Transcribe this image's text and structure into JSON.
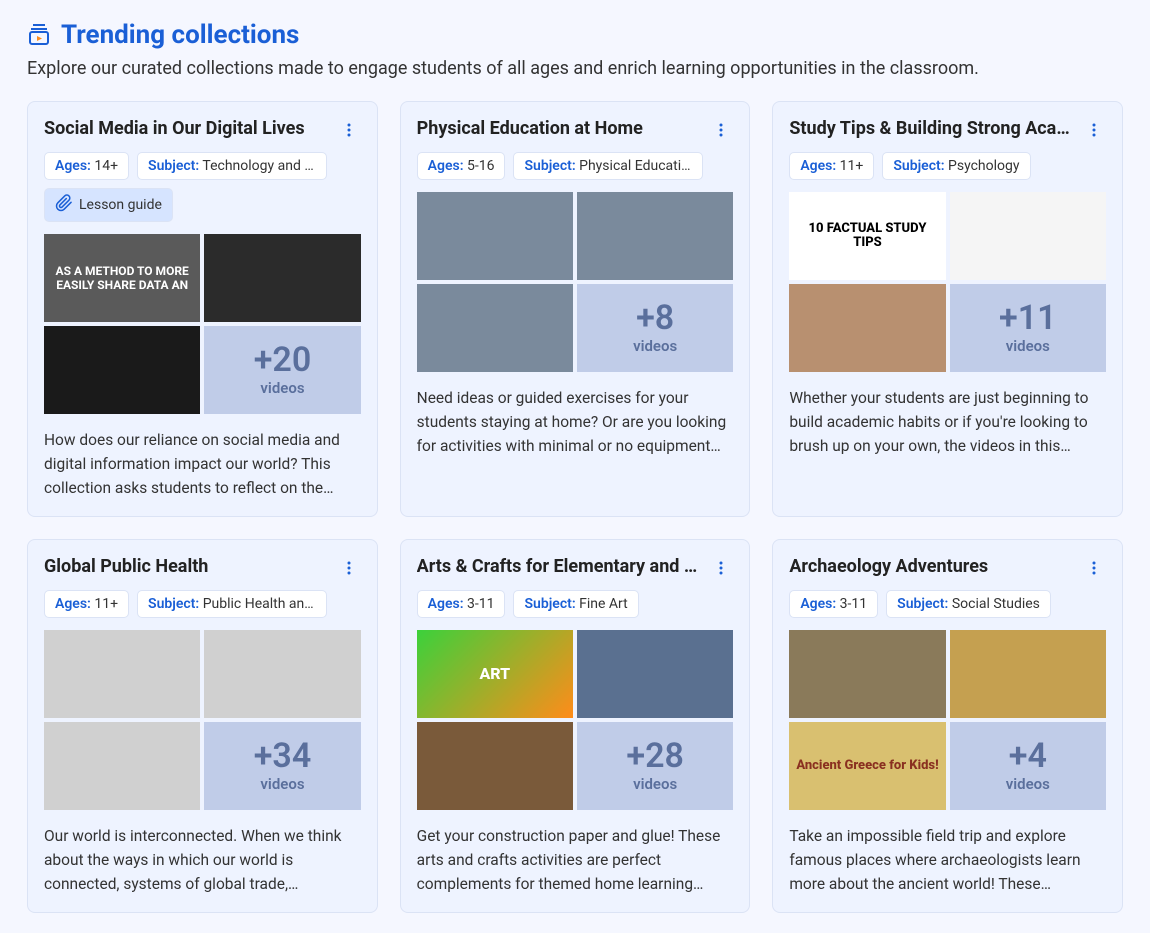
{
  "header": {
    "title": "Trending collections",
    "subtitle": "Explore our curated collections made to engage students of all ages and enrich learning opportunities in the classroom."
  },
  "labels": {
    "ages": "Ages:",
    "subject": "Subject:",
    "lesson_guide": "Lesson guide",
    "videos": "videos"
  },
  "cards": [
    {
      "title": "Social Media in Our Digital Lives",
      "ages": "14+",
      "subject": "Technology and C…",
      "has_lesson_guide": true,
      "more_count": "+20",
      "description": "How does our reliance on social media and digital information impact our world? This collection asks students to reflect on the…",
      "thumbs": [
        "t1",
        "t2",
        "t3"
      ],
      "thumb_text_1": "AS A METHOD TO MORE EASILY SHARE DATA AN"
    },
    {
      "title": "Physical Education at Home",
      "ages": "5-16",
      "subject": "Physical Education",
      "has_lesson_guide": false,
      "more_count": "+8",
      "description": "Need ideas or guided exercises for your students staying at home? Or are you looking for activities with minimal or no equipment…",
      "thumbs": [
        "pe1",
        "pe2",
        "pe3"
      ]
    },
    {
      "title": "Study Tips & Building Strong Acad…",
      "ages": "11+",
      "subject": "Psychology",
      "has_lesson_guide": false,
      "more_count": "+11",
      "description": "Whether your students are just beginning to build academic habits or if you're looking to brush up on your own, the videos in this…",
      "thumbs": [
        "st1",
        "st2",
        "st3"
      ],
      "thumb_text_1": "10 FACTUAL STUDY TIPS"
    },
    {
      "title": "Global Public Health",
      "ages": "11+",
      "subject": "Public Health and …",
      "has_lesson_guide": false,
      "more_count": "+34",
      "description": "Our world is interconnected. When we think about the ways in which our world is connected, systems of global trade,…",
      "thumbs": [
        "gh1",
        "gh2",
        "gh3"
      ]
    },
    {
      "title": "Arts & Crafts for Elementary and E…",
      "ages": "3-11",
      "subject": "Fine Art",
      "has_lesson_guide": false,
      "more_count": "+28",
      "description": "Get your construction paper and glue! These arts and crafts activities are perfect complements for themed home learning…",
      "thumbs": [
        "ac1",
        "ac2",
        "ac3"
      ],
      "thumb_text_1": "ART"
    },
    {
      "title": "Archaeology Adventures",
      "ages": "3-11",
      "subject": "Social Studies",
      "has_lesson_guide": false,
      "more_count": "+4",
      "description": "Take an impossible field trip and explore famous places where archaeologists learn more about the ancient world! These…",
      "thumbs": [
        "ar1",
        "ar2",
        "ar3"
      ],
      "thumb_text_3": "Ancient Greece for Kids!"
    }
  ]
}
